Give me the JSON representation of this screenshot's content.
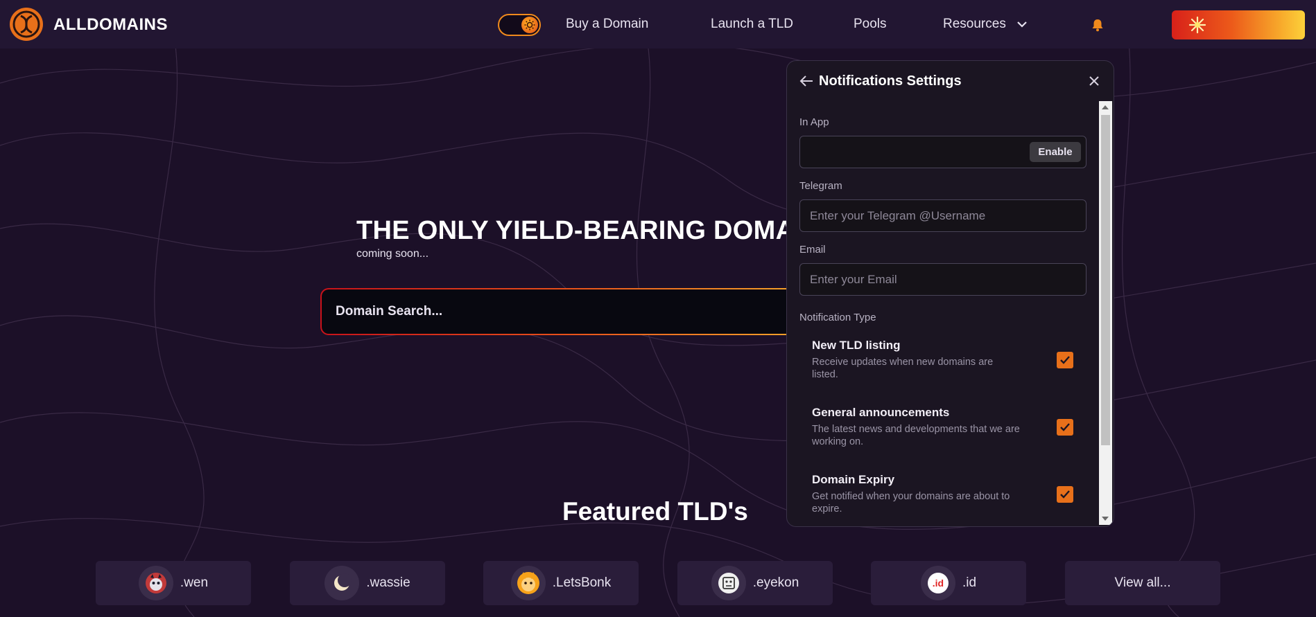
{
  "header": {
    "logo_text": "ALLDOMAINS",
    "nav": {
      "buy": "Buy a Domain",
      "launch": "Launch a TLD",
      "pools": "Pools",
      "resources": "Resources"
    },
    "icons": {
      "logo": "alldomains-logo-icon",
      "theme": "sun-icon",
      "resources_dropdown": "chevron-down-icon",
      "notifications": "bell-icon",
      "wallet": "starburst-icon"
    }
  },
  "hero": {
    "title": "THE ONLY YIELD-BEARING DOMA",
    "subtitle": "coming soon...",
    "search_placeholder": "Domain Search..."
  },
  "featured": {
    "title": "Featured TLD's",
    "tlds": [
      {
        "label": ".wen",
        "icon": "wen-dog-icon"
      },
      {
        "label": ".wassie",
        "icon": "moon-icon"
      },
      {
        "label": ".LetsBonk",
        "icon": "bonk-dog-icon"
      },
      {
        "label": ".eyekon",
        "icon": "eyekon-icon"
      },
      {
        "label": ".id",
        "icon": ".id",
        "icon_color": "#e02424"
      }
    ],
    "view_all": "View all..."
  },
  "notifications_panel": {
    "title": "Notifications Settings",
    "in_app": {
      "label": "In App",
      "button": "Enable"
    },
    "telegram": {
      "label": "Telegram",
      "placeholder": "Enter your Telegram @Username"
    },
    "email": {
      "label": "Email",
      "placeholder": "Enter your Email"
    },
    "type_label": "Notification Type",
    "types": [
      {
        "title": "New TLD listing",
        "desc": "Receive updates when new domains are listed.",
        "checked": true
      },
      {
        "title": "General announcements",
        "desc": "The latest news and developments that we are working on.",
        "checked": true
      },
      {
        "title": "Domain Expiry",
        "desc": "Get notified when your domains are about to expire.",
        "checked": true
      }
    ]
  },
  "colors": {
    "background": "#1c1028",
    "header": "#221632",
    "accent_orange": "#e8701a",
    "panel": "#1b1522"
  }
}
